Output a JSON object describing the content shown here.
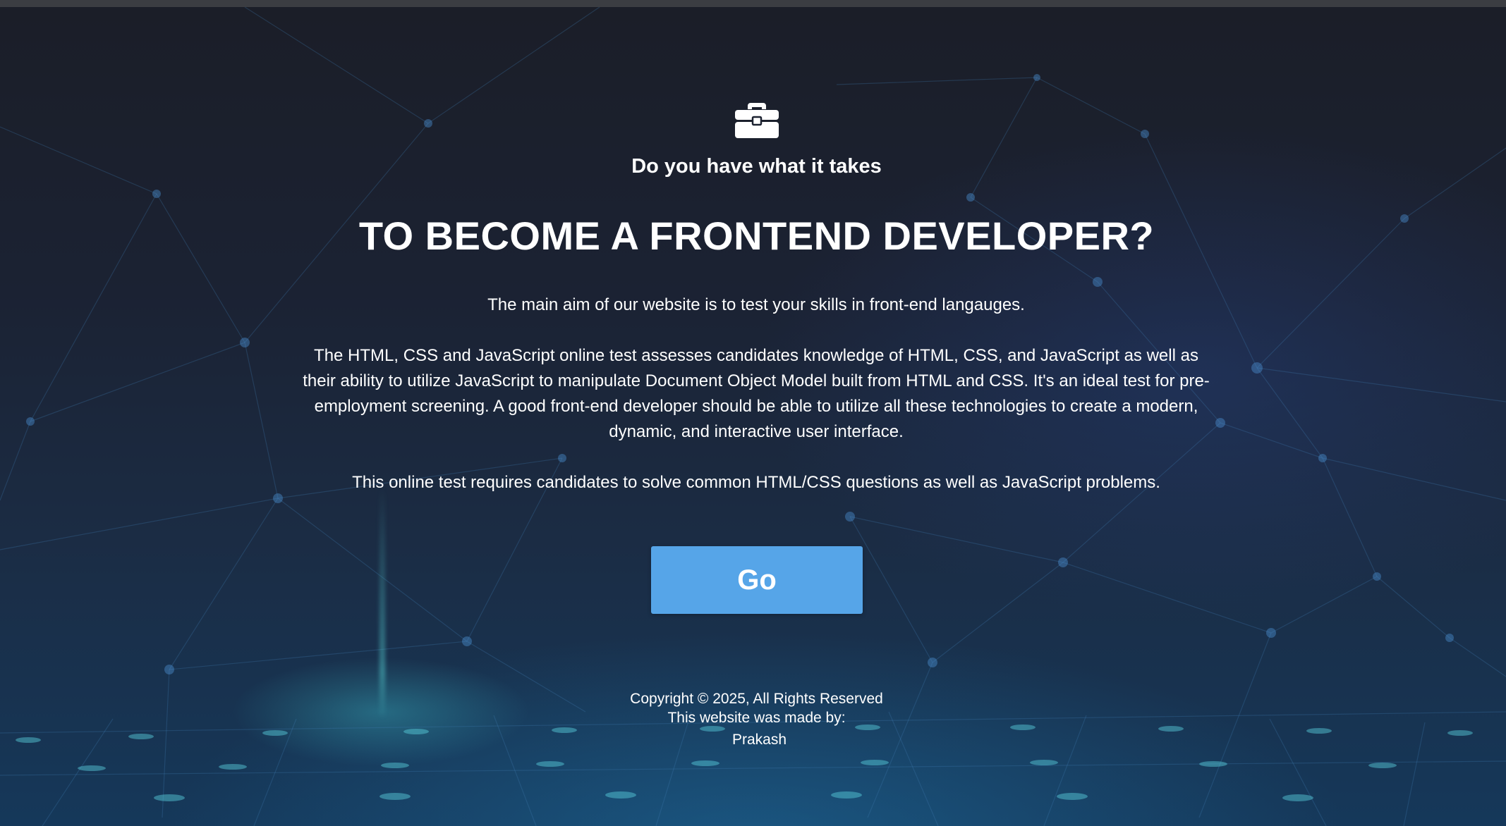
{
  "hero": {
    "icon": "briefcase-icon",
    "tagline": "Do you have what it takes",
    "headline": "TO BECOME A FRONTEND DEVELOPER?",
    "paragraphs": [
      "The main aim of our website is to test your skills in front-end langauges.",
      "The HTML, CSS and JavaScript online test assesses candidates knowledge of HTML, CSS, and JavaScript as well as their ability to utilize JavaScript to manipulate Document Object Model built from HTML and CSS. It's an ideal test for pre-employment screening. A good front-end developer should be able to utilize all these technologies to create a modern, dynamic, and interactive user interface.",
      "This online test requires candidates to solve common HTML/CSS questions as well as JavaScript problems."
    ],
    "go_label": "Go"
  },
  "footer": {
    "copyright": "Copyright © 2025, All Rights Reserved",
    "made_by": "This website was made by:",
    "author": "Prakash"
  },
  "colors": {
    "button": "#56a5e8",
    "background_top": "#1b1e28",
    "background_bottom": "#15385a",
    "network_line": "#3f7fb5"
  }
}
